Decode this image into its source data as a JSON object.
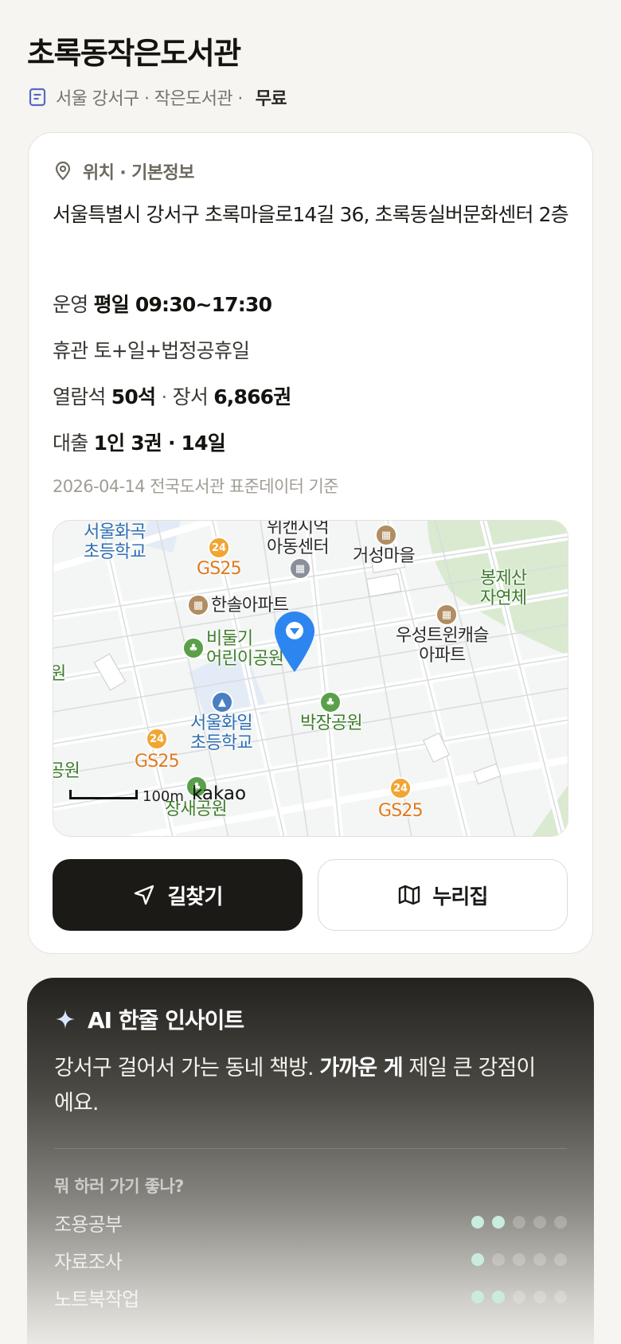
{
  "header": {
    "title": "초록동작은도서관",
    "meta_prefix": "서울 강서구 · 작은도서관 ·",
    "fee": "무료",
    "meta_icon": "document-icon"
  },
  "location": {
    "section_title": "위치 · 기본정보",
    "section_icon": "location-pin-icon",
    "address": "서울특별시 강서구 초록마을로14길 36, 초록동실버문화센터 2층",
    "hours_label": "운영",
    "hours_value": "평일 09:30~17:30",
    "closed_label": "휴관",
    "closed_value": "토+일+법정공휴일",
    "seats_label": "열람석",
    "seats_value": "50석",
    "sep": "·",
    "books_label": "장서",
    "books_value": "6,866권",
    "loan_label": "대출",
    "loan_value": "1인 3권 · 14일",
    "basis": "2026-04-14 전국도서관 표준데이터 기준"
  },
  "map": {
    "labels": {
      "school1": "서울화곡\n초등학교",
      "center": "위캔시억\n아동센터",
      "village": "거성마을",
      "park_mtn": "봉제산\n자연체",
      "gs_top": "GS25",
      "apt_hansol": "한솔아파트",
      "park_bird": "비둘기\n어린이공원",
      "apt_woosung": "우성트윈캐슬\n아파트",
      "park_bakjang": "박장공원",
      "school2": "서울화일\n초등학교",
      "gs_left": "GS25",
      "gs_bottom": "GS25",
      "park_edge_left": "원",
      "park_edge_left2": "공원",
      "park_bottom": "장새공원"
    },
    "scale_text": "100m",
    "provider": "kakao",
    "marker_icon": "map-marker-icon"
  },
  "actions": {
    "directions_label": "길찾기",
    "directions_icon": "navigation-arrow-icon",
    "map_label": "누리집",
    "map_icon": "map-icon"
  },
  "ai": {
    "title": "AI 한줄 인사이트",
    "icon": "sparkle-icon",
    "text_before": "강서구 걸어서 가는 동네 책방. ",
    "text_bold": "가까운 게",
    "text_after": " 제일 큰 강점이에요.",
    "question": "뭐 하러 가기 좋나?",
    "ratings": [
      {
        "label": "조용공부",
        "score": 2,
        "max": 5
      },
      {
        "label": "자료조사",
        "score": 1,
        "max": 5
      },
      {
        "label": "노트북작업",
        "score": 2,
        "max": 5
      }
    ],
    "accent": "#c9ecdf"
  }
}
